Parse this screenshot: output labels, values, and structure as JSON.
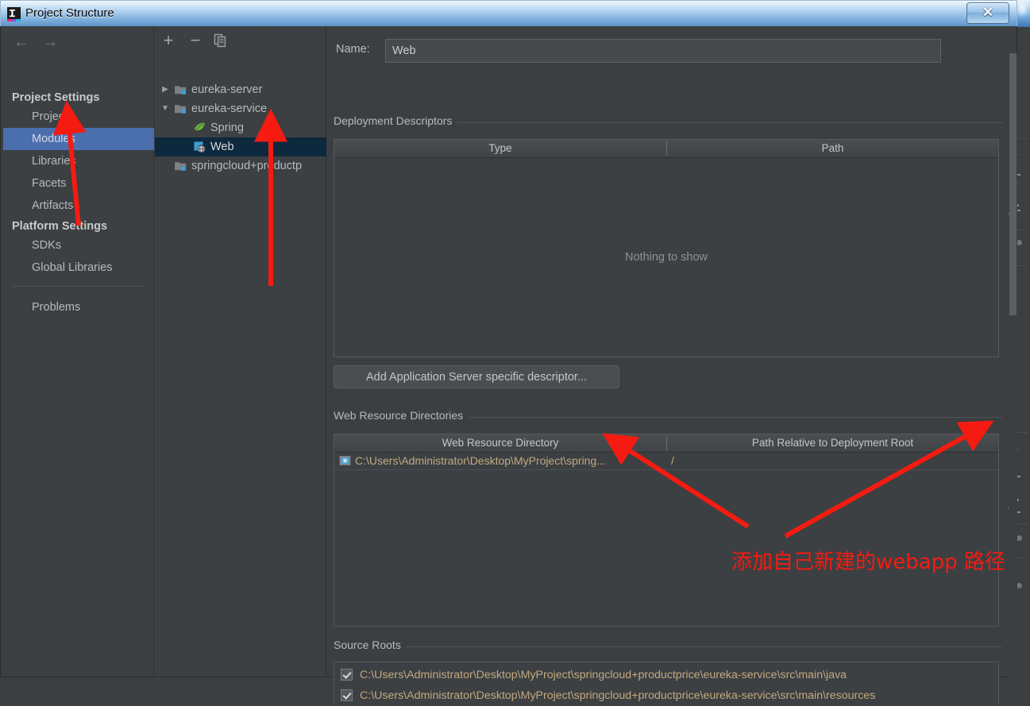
{
  "window": {
    "title": "Project Structure",
    "icon": "intellij-idea-icon",
    "close_label": "✕"
  },
  "sidebar": {
    "nav": {
      "back": "←",
      "forward": "→"
    },
    "groups": [
      {
        "label": "Project Settings",
        "items": [
          {
            "label": "Project",
            "selected": false
          },
          {
            "label": "Modules",
            "selected": true
          },
          {
            "label": "Libraries",
            "selected": false
          },
          {
            "label": "Facets",
            "selected": false
          },
          {
            "label": "Artifacts",
            "selected": false
          }
        ]
      },
      {
        "label": "Platform Settings",
        "items": [
          {
            "label": "SDKs",
            "selected": false
          },
          {
            "label": "Global Libraries",
            "selected": false
          }
        ]
      }
    ],
    "problems": {
      "label": "Problems"
    }
  },
  "tree": {
    "toolbar": [
      {
        "name": "add-module-button",
        "glyph": "+"
      },
      {
        "name": "remove-module-button",
        "glyph": "−"
      },
      {
        "name": "copy-module-button",
        "glyph": "copy-icon"
      }
    ],
    "nodes": [
      {
        "label": "eureka-server",
        "icon": "module-folder-icon",
        "twisty": "▶",
        "depth": 0,
        "selected": false
      },
      {
        "label": "eureka-service",
        "icon": "module-folder-icon",
        "twisty": "▼",
        "depth": 0,
        "selected": false
      },
      {
        "label": "Spring",
        "icon": "spring-leaf-icon",
        "twisty": "",
        "depth": 1,
        "selected": false
      },
      {
        "label": "Web",
        "icon": "web-facet-icon",
        "twisty": "",
        "depth": 1,
        "selected": true
      },
      {
        "label": "springcloud+productp",
        "icon": "module-folder-icon",
        "twisty": "",
        "depth": 0,
        "selected": false
      }
    ]
  },
  "main": {
    "name_label": "Name:",
    "name_value": "Web",
    "deployment_descriptors": {
      "section_label": "Deployment Descriptors",
      "columns": [
        "Type",
        "Path"
      ],
      "rows": [],
      "empty_text": "Nothing to show",
      "toolbar": [
        {
          "name": "add-descriptor-button",
          "glyph": "+"
        },
        {
          "name": "remove-descriptor-button",
          "glyph": "−"
        },
        {
          "name": "edit-descriptor-button",
          "glyph": "pencil-icon"
        }
      ]
    },
    "add_descriptor_button": "Add Application Server specific descriptor...",
    "web_resource_directories": {
      "section_label": "Web Resource Directories",
      "columns": [
        "Web Resource Directory",
        "Path Relative to Deployment Root"
      ],
      "rows": [
        {
          "icon": "folder-web-icon",
          "directory": "C:\\Users\\Administrator\\Desktop\\MyProject\\spring...",
          "relative_path": "/"
        }
      ],
      "toolbar": [
        {
          "name": "add-web-resource-button",
          "glyph": "+"
        },
        {
          "name": "remove-web-resource-button",
          "glyph": "−"
        },
        {
          "name": "edit-web-resource-button",
          "glyph": "pencil-icon"
        },
        {
          "name": "help-button",
          "glyph": "?"
        }
      ]
    },
    "source_roots": {
      "section_label": "Source Roots",
      "rows": [
        {
          "checked": true,
          "path": "C:\\Users\\Administrator\\Desktop\\MyProject\\springcloud+productprice\\eureka-service\\src\\main\\java"
        },
        {
          "checked": true,
          "path": "C:\\Users\\Administrator\\Desktop\\MyProject\\springcloud+productprice\\eureka-service\\src\\main\\resources"
        }
      ]
    }
  },
  "annotation": {
    "text": "添加自己新建的webapp 路径",
    "color": "#f51b11"
  },
  "colors": {
    "dialog_bg": "#3c3f41",
    "panel_bg": "#3c4043",
    "selection_blue": "#4b6eaf",
    "tree_selection": "#0d293e",
    "text": "#b4bac0",
    "path_text": "#c2a87e",
    "accent": "#4b8fd0"
  }
}
